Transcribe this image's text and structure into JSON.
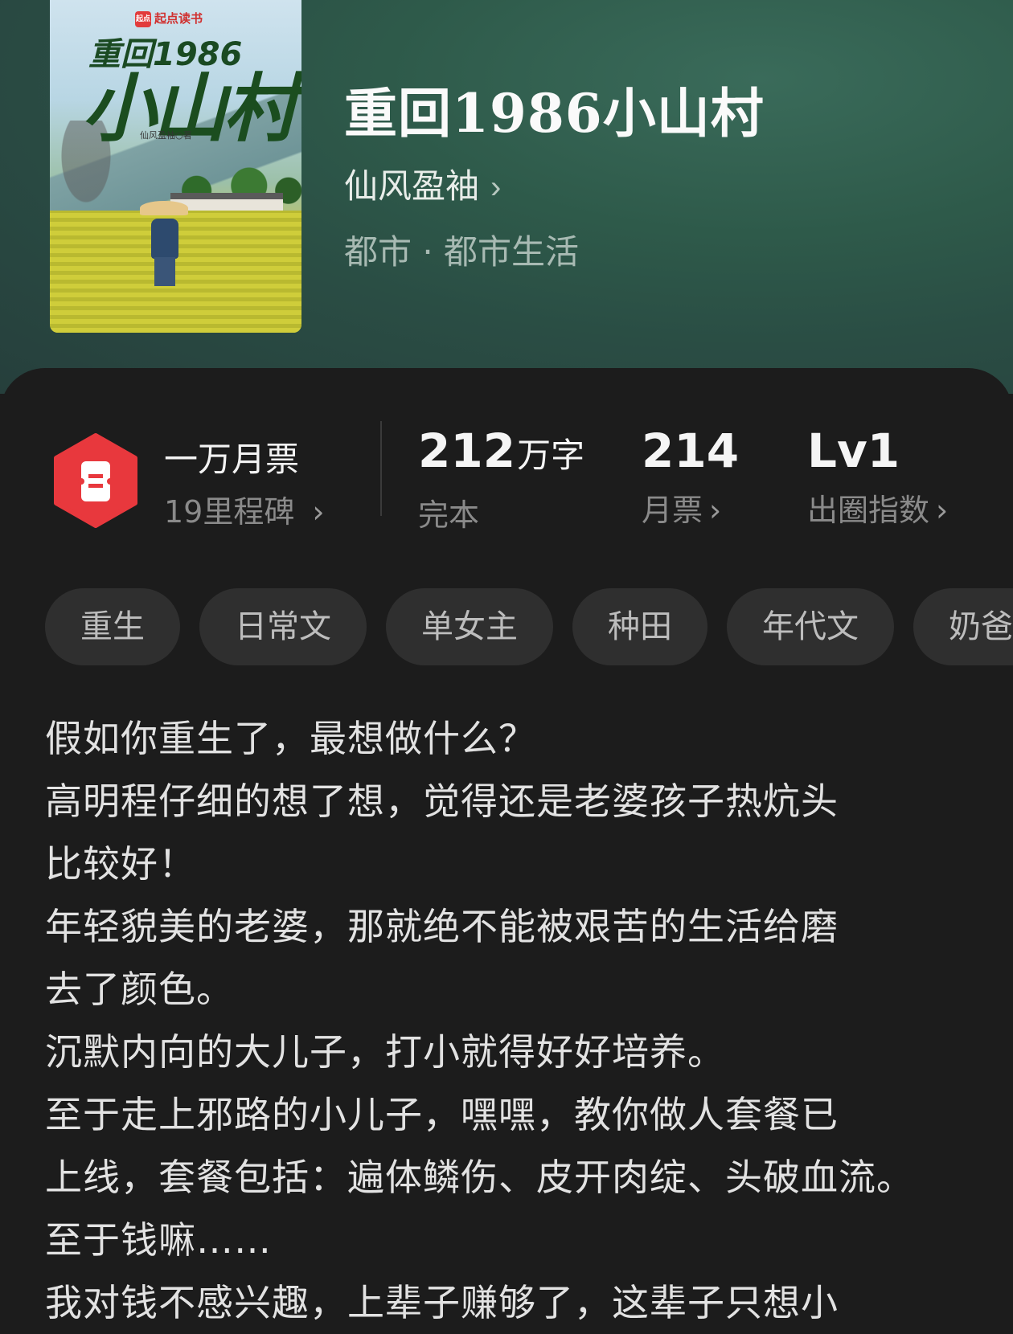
{
  "book": {
    "cover_brand": "起点读书",
    "cover_title_line1": "重回1986",
    "cover_title_line2": "小山村",
    "cover_author": "仙风盈袖○著",
    "title": "重回1986小山村",
    "author": "仙风盈袖",
    "genre": "都市 · 都市生活"
  },
  "ticket": {
    "title": "一万月票",
    "subtitle": "19里程碑"
  },
  "stats": {
    "words_value": "212",
    "words_unit": "万字",
    "words_label": "完本",
    "votes_value": "214",
    "votes_label": "月票",
    "index_value": "Lv1",
    "index_label": "出圈指数"
  },
  "tags": [
    "重生",
    "日常文",
    "单女主",
    "种田",
    "年代文",
    "奶爸"
  ],
  "description": [
    "假如你重生了，最想做什么？",
    "高明程仔细的想了想，觉得还是老婆孩子热炕头",
    "比较好！",
    "年轻貌美的老婆，那就绝不能被艰苦的生活给磨",
    "去了颜色。",
    "沉默内向的大儿子，打小就得好好培养。",
    "至于走上邪路的小儿子，嘿嘿，教你做人套餐已",
    "上线，套餐包括：遍体鳞伤、皮开肉绽、头破血流。",
    "至于钱嘛……",
    "我对钱不感兴趣，上辈子赚够了，这辈子只想小"
  ],
  "colors": {
    "badge_red": "#e8383d",
    "hero_green": "#2e5a4a",
    "background": "#1c1c1c",
    "tag_bg": "#2f2f2f"
  },
  "icons": {
    "chevron": "chevron-right-icon",
    "badge": "monthly-ticket-icon"
  }
}
